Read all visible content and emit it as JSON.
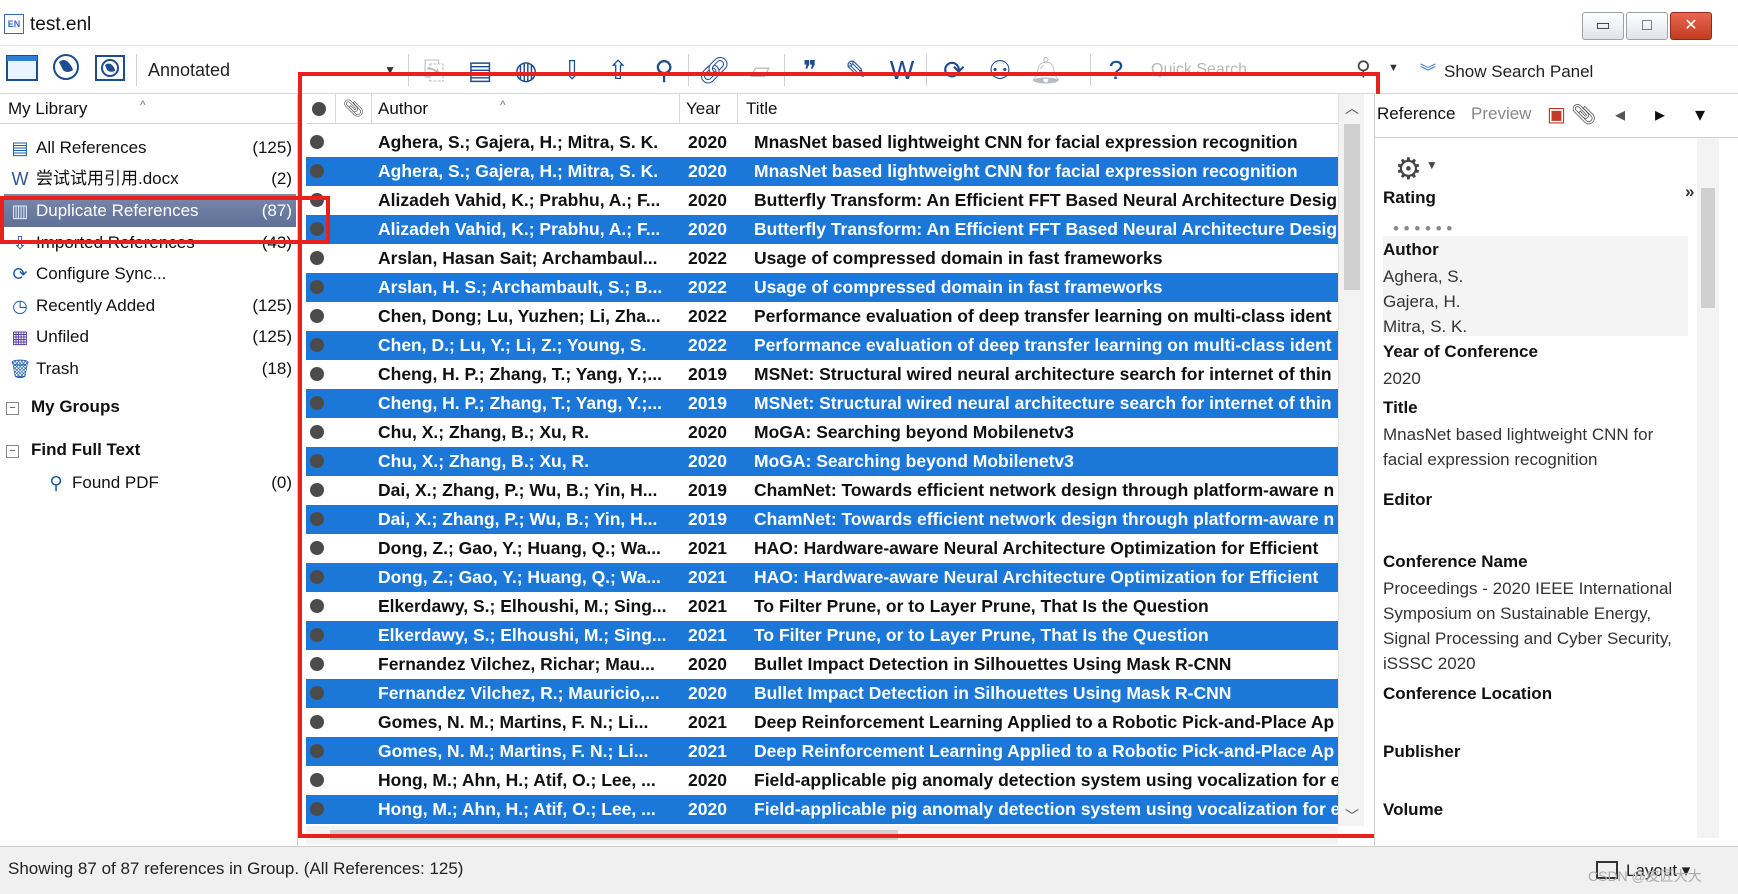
{
  "window": {
    "app_icon_text": "EN",
    "title": "test.enl",
    "controls": {
      "minimize": "▭",
      "maximize": "□",
      "close": "✕"
    }
  },
  "toolbar": {
    "style_value": "Annotated",
    "quick_search_placeholder": "Quick Search",
    "show_search_panel": "Show Search Panel"
  },
  "library": {
    "header": "My Library",
    "groups": [
      {
        "name": "All References",
        "count": "(125)",
        "icon": "stack-icon"
      },
      {
        "name": "尝试试用引用.docx",
        "count": "(2)",
        "icon": "word-doc-icon"
      },
      {
        "name": "Duplicate References",
        "count": "(87)",
        "icon": "duplicate-icon"
      },
      {
        "name": "Imported References",
        "count": "(43)",
        "icon": "import-icon"
      },
      {
        "name": "Configure Sync...",
        "count": "",
        "icon": "sync-icon"
      },
      {
        "name": "Recently Added",
        "count": "(125)",
        "icon": "clock-icon"
      },
      {
        "name": "Unfiled",
        "count": "(125)",
        "icon": "unfiled-icon"
      },
      {
        "name": "Trash",
        "count": "(18)",
        "icon": "trash-icon"
      }
    ],
    "my_groups_label": "My Groups",
    "find_full_text_label": "Find Full Text",
    "found_pdf": {
      "name": "Found PDF",
      "count": "(0)"
    }
  },
  "list": {
    "columns": {
      "author": "Author",
      "year": "Year",
      "title": "Title"
    },
    "rows": [
      {
        "author": "Aghera, S.; Gajera, H.; Mitra, S. K.",
        "year": "2020",
        "title": "MnasNet based lightweight CNN for facial expression recognition"
      },
      {
        "author": "Aghera, S.; Gajera, H.; Mitra, S. K.",
        "year": "2020",
        "title": "MnasNet based lightweight CNN for facial expression recognition"
      },
      {
        "author": "Alizadeh Vahid, K.; Prabhu, A.; F...",
        "year": "2020",
        "title": "Butterfly Transform: An Efficient FFT Based Neural Architecture Desig"
      },
      {
        "author": "Alizadeh Vahid, K.; Prabhu, A.; F...",
        "year": "2020",
        "title": "Butterfly Transform: An Efficient FFT Based Neural Architecture Desig"
      },
      {
        "author": "Arslan, Hasan Sait; Archambaul...",
        "year": "2022",
        "title": "Usage of compressed domain in fast frameworks"
      },
      {
        "author": "Arslan, H. S.; Archambault, S.; B...",
        "year": "2022",
        "title": "Usage of compressed domain in fast frameworks"
      },
      {
        "author": "Chen, Dong; Lu, Yuzhen; Li, Zha...",
        "year": "2022",
        "title": "Performance evaluation of deep transfer learning on multi-class ident"
      },
      {
        "author": "Chen, D.; Lu, Y.; Li, Z.; Young, S.",
        "year": "2022",
        "title": "Performance evaluation of deep transfer learning on multi-class ident"
      },
      {
        "author": "Cheng, H. P.; Zhang, T.; Yang, Y.;...",
        "year": "2019",
        "title": "MSNet: Structural wired neural architecture search for internet of thin"
      },
      {
        "author": "Cheng, H. P.; Zhang, T.; Yang, Y.;...",
        "year": "2019",
        "title": "MSNet: Structural wired neural architecture search for internet of thin"
      },
      {
        "author": "Chu, X.; Zhang, B.; Xu, R.",
        "year": "2020",
        "title": "MoGA: Searching beyond Mobilenetv3"
      },
      {
        "author": "Chu, X.; Zhang, B.; Xu, R.",
        "year": "2020",
        "title": "MoGA: Searching beyond Mobilenetv3"
      },
      {
        "author": "Dai, X.; Zhang, P.; Wu, B.; Yin, H...",
        "year": "2019",
        "title": "ChamNet: Towards efficient network design through platform-aware n"
      },
      {
        "author": "Dai, X.; Zhang, P.; Wu, B.; Yin, H...",
        "year": "2019",
        "title": "ChamNet: Towards efficient network design through platform-aware n"
      },
      {
        "author": "Dong, Z.; Gao, Y.; Huang, Q.; Wa...",
        "year": "2021",
        "title": "HAO: Hardware-aware Neural Architecture Optimization for Efficient"
      },
      {
        "author": "Dong, Z.; Gao, Y.; Huang, Q.; Wa...",
        "year": "2021",
        "title": "HAO: Hardware-aware Neural Architecture Optimization for Efficient"
      },
      {
        "author": "Elkerdawy, S.; Elhoushi, M.; Sing...",
        "year": "2021",
        "title": "To Filter Prune, or to Layer Prune, That Is the Question"
      },
      {
        "author": "Elkerdawy, S.; Elhoushi, M.; Sing...",
        "year": "2021",
        "title": "To Filter Prune, or to Layer Prune, That Is the Question"
      },
      {
        "author": "Fernandez Vilchez, Richar; Mau...",
        "year": "2020",
        "title": "Bullet Impact Detection in Silhouettes Using Mask R-CNN"
      },
      {
        "author": "Fernandez Vilchez, R.; Mauricio,...",
        "year": "2020",
        "title": "Bullet Impact Detection in Silhouettes Using Mask R-CNN"
      },
      {
        "author": "Gomes, N. M.; Martins, F. N.; Li...",
        "year": "2021",
        "title": "Deep Reinforcement Learning Applied to a Robotic Pick-and-Place Ap"
      },
      {
        "author": "Gomes, N. M.; Martins, F. N.; Li...",
        "year": "2021",
        "title": "Deep Reinforcement Learning Applied to a Robotic Pick-and-Place Ap"
      },
      {
        "author": "Hong, M.; Ahn, H.; Atif, O.; Lee, ...",
        "year": "2020",
        "title": "Field-applicable pig anomaly detection system using vocalization for e"
      },
      {
        "author": "Hong, M.; Ahn, H.; Atif, O.; Lee, ...",
        "year": "2020",
        "title": "Field-applicable pig anomaly detection system using vocalization for e"
      }
    ]
  },
  "reference_panel": {
    "tabs": {
      "reference": "Reference",
      "preview": "Preview"
    },
    "rating_label": "Rating",
    "rating_dots": "• • • • • •",
    "author_label": "Author",
    "authors": [
      "Aghera, S.",
      "Gajera, H.",
      "Mitra, S. K."
    ],
    "year_label": "Year of Conference",
    "year_value": "2020",
    "title_label": "Title",
    "title_value": "MnasNet based lightweight CNN for facial expression recognition",
    "editor_label": "Editor",
    "conference_name_label": "Conference Name",
    "conference_name_value": "Proceedings - 2020 IEEE International Symposium on Sustainable Energy, Signal Processing and Cyber Security, iSSSC 2020",
    "conference_location_label": "Conference Location",
    "publisher_label": "Publisher",
    "volume_label": "Volume"
  },
  "status": {
    "text": "Showing 87 of 87 references in Group. (All References: 125)",
    "layout_label": "Layout"
  },
  "watermark": "CSDN @皮匠大大",
  "colors": {
    "row_highlight": "#1b78d9",
    "selected_group": "#6b7ba3",
    "annotation_box": "#e8211d"
  }
}
